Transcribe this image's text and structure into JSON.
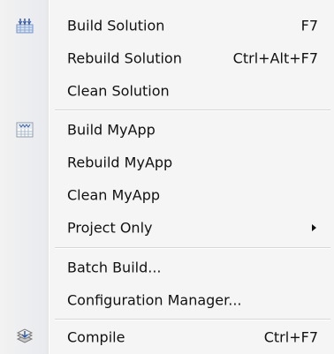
{
  "menu": {
    "items": [
      {
        "label": "Build Solution",
        "shortcut": "F7",
        "icon": "build-solution-icon"
      },
      {
        "label": "Rebuild Solution",
        "shortcut": "Ctrl+Alt+F7"
      },
      {
        "label": "Clean Solution",
        "shortcut": ""
      },
      {
        "label": "Build MyApp",
        "shortcut": "",
        "icon": "build-project-icon"
      },
      {
        "label": "Rebuild MyApp",
        "shortcut": ""
      },
      {
        "label": "Clean MyApp",
        "shortcut": ""
      },
      {
        "label": "Project Only",
        "shortcut": "",
        "has_submenu": true
      },
      {
        "label": "Batch Build...",
        "shortcut": ""
      },
      {
        "label": "Configuration Manager...",
        "shortcut": ""
      },
      {
        "label": "Compile",
        "shortcut": "Ctrl+F7",
        "icon": "compile-icon"
      }
    ]
  }
}
